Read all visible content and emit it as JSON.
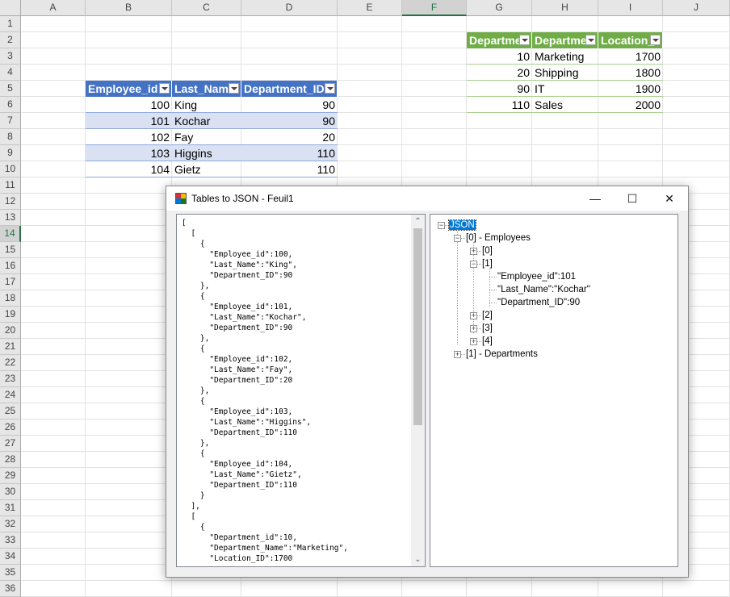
{
  "sheet": {
    "columns": [
      "A",
      "B",
      "C",
      "D",
      "E",
      "F",
      "G",
      "H",
      "I",
      "J"
    ],
    "selected_column": "F",
    "rows": [
      "1",
      "2",
      "3",
      "4",
      "5",
      "6",
      "7",
      "8",
      "9",
      "10",
      "11",
      "12",
      "13",
      "14",
      "15",
      "16",
      "17",
      "18",
      "19",
      "20",
      "21",
      "22",
      "23",
      "24",
      "25",
      "26",
      "27",
      "28",
      "29",
      "30",
      "31",
      "32",
      "33",
      "34",
      "35",
      "36"
    ],
    "selected_row": "14"
  },
  "employees_table": {
    "headers": [
      "Employee_id",
      "Last_Name",
      "Department_ID"
    ],
    "rows": [
      [
        "100",
        "King",
        "90"
      ],
      [
        "101",
        "Kochar",
        "90"
      ],
      [
        "102",
        "Fay",
        "20"
      ],
      [
        "103",
        "Higgins",
        "110"
      ],
      [
        "104",
        "Gietz",
        "110"
      ]
    ],
    "header_color": "#4472c4",
    "band_color": "#d9e1f2"
  },
  "departments_table": {
    "headers": [
      "Departme",
      "Departme",
      "Location_"
    ],
    "rows": [
      [
        "10",
        "Marketing",
        "1700"
      ],
      [
        "20",
        "Shipping",
        "1800"
      ],
      [
        "90",
        "IT",
        "1900"
      ],
      [
        "110",
        "Sales",
        "2000"
      ]
    ],
    "header_color": "#70ad47"
  },
  "dialog": {
    "title": "Tables to JSON - Feuil1",
    "icon": "table-app-icon",
    "minimize_glyph": "—",
    "maximize_glyph": "☐",
    "close_glyph": "✕",
    "json_text": "[\n  [\n    {\n      \"Employee_id\":100,\n      \"Last_Name\":\"King\",\n      \"Department_ID\":90\n    },\n    {\n      \"Employee_id\":101,\n      \"Last_Name\":\"Kochar\",\n      \"Department_ID\":90\n    },\n    {\n      \"Employee_id\":102,\n      \"Last_Name\":\"Fay\",\n      \"Department_ID\":20\n    },\n    {\n      \"Employee_id\":103,\n      \"Last_Name\":\"Higgins\",\n      \"Department_ID\":110\n    },\n    {\n      \"Employee_id\":104,\n      \"Last_Name\":\"Gietz\",\n      \"Department_ID\":110\n    }\n  ],\n  [\n    {\n      \"Department_id\":10,\n      \"Department_Name\":\"Marketing\",\n      \"Location_ID\":1700",
    "scroll_up_glyph": "⌃",
    "scroll_down_glyph": "⌄",
    "tree": {
      "root": "JSON",
      "employees": "[0] - Employees",
      "item0": "[0]",
      "item1": "[1]",
      "item1_fields": [
        "\"Employee_id\":101",
        "\"Last_Name\":\"Kochar\"",
        "\"Department_ID\":90"
      ],
      "item2": "[2]",
      "item3": "[3]",
      "item4": "[4]",
      "departments": "[1] - Departments",
      "expanded_glyph": "−",
      "collapsed_glyph": "+"
    }
  }
}
